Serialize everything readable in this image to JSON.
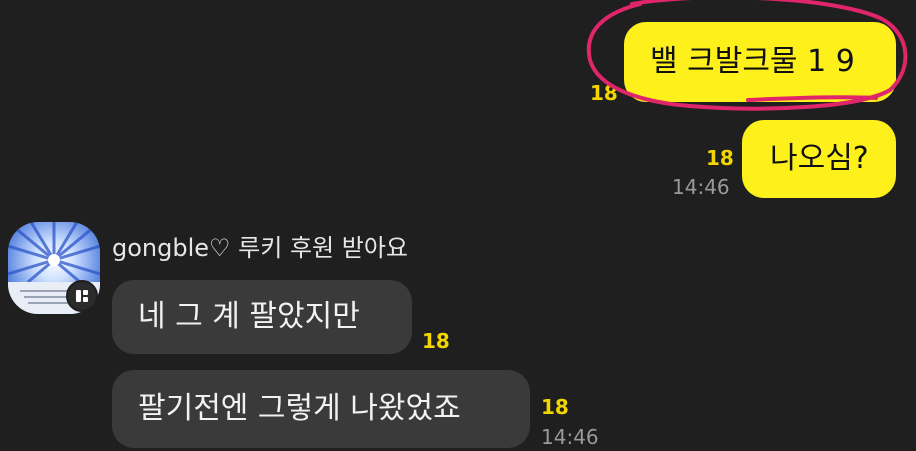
{
  "messages_mine": [
    {
      "text": "밸 크발크물 1 9",
      "count": "18"
    },
    {
      "text": "나오심?",
      "count": "18",
      "time": "14:46"
    }
  ],
  "other_user": {
    "name": "gongble♡ 루키 후원 받아요",
    "avatar_icon": "profile-avatar",
    "badge_icon": "device-badge-icon"
  },
  "messages_theirs": [
    {
      "text": "네 그 계 팔았지만",
      "count": "18"
    },
    {
      "text": "팔기전엔 그렇게 나왔었죠",
      "count": "18",
      "time": "14:46"
    }
  ],
  "colors": {
    "background": "#1f1f1f",
    "my_bubble": "#fef01b",
    "their_bubble": "#3a3a3a",
    "unread_count": "#f2d600",
    "annotation": "#e0266a"
  }
}
